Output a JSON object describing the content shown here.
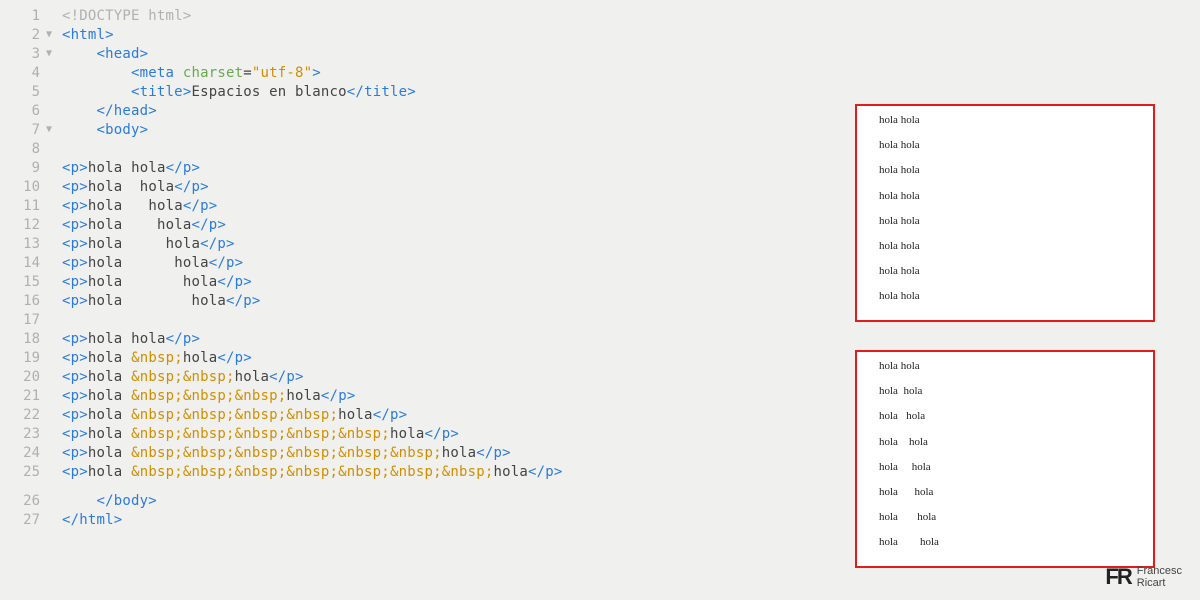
{
  "editor": {
    "lines": [
      {
        "n": 1,
        "fold": "",
        "code": [
          {
            "cls": "doctype",
            "t": "<!DOCTYPE html>"
          }
        ],
        "indent": 0
      },
      {
        "n": 2,
        "fold": "▼",
        "code": [
          {
            "cls": "bracket",
            "t": "<"
          },
          {
            "cls": "tag",
            "t": "html"
          },
          {
            "cls": "bracket",
            "t": ">"
          }
        ],
        "indent": 0
      },
      {
        "n": 3,
        "fold": "▼",
        "code": [
          {
            "cls": "bracket",
            "t": "<"
          },
          {
            "cls": "tag",
            "t": "head"
          },
          {
            "cls": "bracket",
            "t": ">"
          }
        ],
        "indent": 1
      },
      {
        "n": 4,
        "fold": "",
        "code": [
          {
            "cls": "bracket",
            "t": "<"
          },
          {
            "cls": "tag",
            "t": "meta"
          },
          {
            "cls": "text",
            "t": " "
          },
          {
            "cls": "attr",
            "t": "charset"
          },
          {
            "cls": "text",
            "t": "="
          },
          {
            "cls": "string",
            "t": "\"utf-8\""
          },
          {
            "cls": "bracket",
            "t": ">"
          }
        ],
        "indent": 2
      },
      {
        "n": 5,
        "fold": "",
        "code": [
          {
            "cls": "bracket",
            "t": "<"
          },
          {
            "cls": "tag",
            "t": "title"
          },
          {
            "cls": "bracket",
            "t": ">"
          },
          {
            "cls": "text",
            "t": "Espacios en blanco"
          },
          {
            "cls": "bracket",
            "t": "</"
          },
          {
            "cls": "tag",
            "t": "title"
          },
          {
            "cls": "bracket",
            "t": ">"
          }
        ],
        "indent": 2
      },
      {
        "n": 6,
        "fold": "",
        "code": [
          {
            "cls": "bracket",
            "t": "</"
          },
          {
            "cls": "tag",
            "t": "head"
          },
          {
            "cls": "bracket",
            "t": ">"
          }
        ],
        "indent": 1
      },
      {
        "n": 7,
        "fold": "▼",
        "code": [
          {
            "cls": "bracket",
            "t": "<"
          },
          {
            "cls": "tag",
            "t": "body"
          },
          {
            "cls": "bracket",
            "t": ">"
          }
        ],
        "indent": 1
      },
      {
        "n": 8,
        "fold": "",
        "code": [],
        "indent": 0
      },
      {
        "n": 9,
        "fold": "",
        "code": [
          {
            "cls": "bracket",
            "t": "<"
          },
          {
            "cls": "tag",
            "t": "p"
          },
          {
            "cls": "bracket",
            "t": ">"
          },
          {
            "cls": "text",
            "t": "hola hola"
          },
          {
            "cls": "bracket",
            "t": "</"
          },
          {
            "cls": "tag",
            "t": "p"
          },
          {
            "cls": "bracket",
            "t": ">"
          }
        ],
        "indent": 0
      },
      {
        "n": 10,
        "fold": "",
        "code": [
          {
            "cls": "bracket",
            "t": "<"
          },
          {
            "cls": "tag",
            "t": "p"
          },
          {
            "cls": "bracket",
            "t": ">"
          },
          {
            "cls": "text",
            "t": "hola  hola"
          },
          {
            "cls": "bracket",
            "t": "</"
          },
          {
            "cls": "tag",
            "t": "p"
          },
          {
            "cls": "bracket",
            "t": ">"
          }
        ],
        "indent": 0
      },
      {
        "n": 11,
        "fold": "",
        "code": [
          {
            "cls": "bracket",
            "t": "<"
          },
          {
            "cls": "tag",
            "t": "p"
          },
          {
            "cls": "bracket",
            "t": ">"
          },
          {
            "cls": "text",
            "t": "hola   hola"
          },
          {
            "cls": "bracket",
            "t": "</"
          },
          {
            "cls": "tag",
            "t": "p"
          },
          {
            "cls": "bracket",
            "t": ">"
          }
        ],
        "indent": 0
      },
      {
        "n": 12,
        "fold": "",
        "code": [
          {
            "cls": "bracket",
            "t": "<"
          },
          {
            "cls": "tag",
            "t": "p"
          },
          {
            "cls": "bracket",
            "t": ">"
          },
          {
            "cls": "text",
            "t": "hola    hola"
          },
          {
            "cls": "bracket",
            "t": "</"
          },
          {
            "cls": "tag",
            "t": "p"
          },
          {
            "cls": "bracket",
            "t": ">"
          }
        ],
        "indent": 0
      },
      {
        "n": 13,
        "fold": "",
        "code": [
          {
            "cls": "bracket",
            "t": "<"
          },
          {
            "cls": "tag",
            "t": "p"
          },
          {
            "cls": "bracket",
            "t": ">"
          },
          {
            "cls": "text",
            "t": "hola     hola"
          },
          {
            "cls": "bracket",
            "t": "</"
          },
          {
            "cls": "tag",
            "t": "p"
          },
          {
            "cls": "bracket",
            "t": ">"
          }
        ],
        "indent": 0
      },
      {
        "n": 14,
        "fold": "",
        "code": [
          {
            "cls": "bracket",
            "t": "<"
          },
          {
            "cls": "tag",
            "t": "p"
          },
          {
            "cls": "bracket",
            "t": ">"
          },
          {
            "cls": "text",
            "t": "hola      hola"
          },
          {
            "cls": "bracket",
            "t": "</"
          },
          {
            "cls": "tag",
            "t": "p"
          },
          {
            "cls": "bracket",
            "t": ">"
          }
        ],
        "indent": 0
      },
      {
        "n": 15,
        "fold": "",
        "code": [
          {
            "cls": "bracket",
            "t": "<"
          },
          {
            "cls": "tag",
            "t": "p"
          },
          {
            "cls": "bracket",
            "t": ">"
          },
          {
            "cls": "text",
            "t": "hola       hola"
          },
          {
            "cls": "bracket",
            "t": "</"
          },
          {
            "cls": "tag",
            "t": "p"
          },
          {
            "cls": "bracket",
            "t": ">"
          }
        ],
        "indent": 0
      },
      {
        "n": 16,
        "fold": "",
        "code": [
          {
            "cls": "bracket",
            "t": "<"
          },
          {
            "cls": "tag",
            "t": "p"
          },
          {
            "cls": "bracket",
            "t": ">"
          },
          {
            "cls": "text",
            "t": "hola        hola"
          },
          {
            "cls": "bracket",
            "t": "</"
          },
          {
            "cls": "tag",
            "t": "p"
          },
          {
            "cls": "bracket",
            "t": ">"
          }
        ],
        "indent": 0
      },
      {
        "n": 17,
        "fold": "",
        "code": [],
        "indent": 0
      },
      {
        "n": 18,
        "fold": "",
        "code": [
          {
            "cls": "bracket",
            "t": "<"
          },
          {
            "cls": "tag",
            "t": "p"
          },
          {
            "cls": "bracket",
            "t": ">"
          },
          {
            "cls": "text",
            "t": "hola hola"
          },
          {
            "cls": "bracket",
            "t": "</"
          },
          {
            "cls": "tag",
            "t": "p"
          },
          {
            "cls": "bracket",
            "t": ">"
          }
        ],
        "indent": 0
      },
      {
        "n": 19,
        "fold": "",
        "code": [
          {
            "cls": "bracket",
            "t": "<"
          },
          {
            "cls": "tag",
            "t": "p"
          },
          {
            "cls": "bracket",
            "t": ">"
          },
          {
            "cls": "text",
            "t": "hola "
          },
          {
            "cls": "entity",
            "t": "&nbsp;"
          },
          {
            "cls": "text",
            "t": "hola"
          },
          {
            "cls": "bracket",
            "t": "</"
          },
          {
            "cls": "tag",
            "t": "p"
          },
          {
            "cls": "bracket",
            "t": ">"
          }
        ],
        "indent": 0
      },
      {
        "n": 20,
        "fold": "",
        "code": [
          {
            "cls": "bracket",
            "t": "<"
          },
          {
            "cls": "tag",
            "t": "p"
          },
          {
            "cls": "bracket",
            "t": ">"
          },
          {
            "cls": "text",
            "t": "hola "
          },
          {
            "cls": "entity",
            "t": "&nbsp;&nbsp;"
          },
          {
            "cls": "text",
            "t": "hola"
          },
          {
            "cls": "bracket",
            "t": "</"
          },
          {
            "cls": "tag",
            "t": "p"
          },
          {
            "cls": "bracket",
            "t": ">"
          }
        ],
        "indent": 0
      },
      {
        "n": 21,
        "fold": "",
        "code": [
          {
            "cls": "bracket",
            "t": "<"
          },
          {
            "cls": "tag",
            "t": "p"
          },
          {
            "cls": "bracket",
            "t": ">"
          },
          {
            "cls": "text",
            "t": "hola "
          },
          {
            "cls": "entity",
            "t": "&nbsp;&nbsp;&nbsp;"
          },
          {
            "cls": "text",
            "t": "hola"
          },
          {
            "cls": "bracket",
            "t": "</"
          },
          {
            "cls": "tag",
            "t": "p"
          },
          {
            "cls": "bracket",
            "t": ">"
          }
        ],
        "indent": 0
      },
      {
        "n": 22,
        "fold": "",
        "code": [
          {
            "cls": "bracket",
            "t": "<"
          },
          {
            "cls": "tag",
            "t": "p"
          },
          {
            "cls": "bracket",
            "t": ">"
          },
          {
            "cls": "text",
            "t": "hola "
          },
          {
            "cls": "entity",
            "t": "&nbsp;&nbsp;&nbsp;&nbsp;"
          },
          {
            "cls": "text",
            "t": "hola"
          },
          {
            "cls": "bracket",
            "t": "</"
          },
          {
            "cls": "tag",
            "t": "p"
          },
          {
            "cls": "bracket",
            "t": ">"
          }
        ],
        "indent": 0
      },
      {
        "n": 23,
        "fold": "",
        "code": [
          {
            "cls": "bracket",
            "t": "<"
          },
          {
            "cls": "tag",
            "t": "p"
          },
          {
            "cls": "bracket",
            "t": ">"
          },
          {
            "cls": "text",
            "t": "hola "
          },
          {
            "cls": "entity",
            "t": "&nbsp;&nbsp;&nbsp;&nbsp;&nbsp;"
          },
          {
            "cls": "text",
            "t": "hola"
          },
          {
            "cls": "bracket",
            "t": "</"
          },
          {
            "cls": "tag",
            "t": "p"
          },
          {
            "cls": "bracket",
            "t": ">"
          }
        ],
        "indent": 0
      },
      {
        "n": 24,
        "fold": "",
        "code": [
          {
            "cls": "bracket",
            "t": "<"
          },
          {
            "cls": "tag",
            "t": "p"
          },
          {
            "cls": "bracket",
            "t": ">"
          },
          {
            "cls": "text",
            "t": "hola "
          },
          {
            "cls": "entity",
            "t": "&nbsp;&nbsp;&nbsp;&nbsp;&nbsp;&nbsp;"
          },
          {
            "cls": "text",
            "t": "hola"
          },
          {
            "cls": "bracket",
            "t": "</"
          },
          {
            "cls": "tag",
            "t": "p"
          },
          {
            "cls": "bracket",
            "t": ">"
          }
        ],
        "indent": 0
      },
      {
        "n": 25,
        "fold": "",
        "code": [
          {
            "cls": "bracket",
            "t": "<"
          },
          {
            "cls": "tag",
            "t": "p"
          },
          {
            "cls": "bracket",
            "t": ">"
          },
          {
            "cls": "text",
            "t": "hola "
          },
          {
            "cls": "entity",
            "t": "&nbsp;&nbsp;&nbsp;&nbsp;&nbsp;&nbsp;&nbsp;"
          },
          {
            "cls": "text",
            "t": "hola"
          },
          {
            "cls": "bracket",
            "t": "</"
          },
          {
            "cls": "tag",
            "t": "p"
          },
          {
            "cls": "bracket",
            "t": ">"
          }
        ],
        "indent": 0
      }
    ],
    "tail": [
      {
        "n": 26,
        "fold": "",
        "code": [
          {
            "cls": "bracket",
            "t": "</"
          },
          {
            "cls": "tag",
            "t": "body"
          },
          {
            "cls": "bracket",
            "t": ">"
          }
        ],
        "indent": 1
      },
      {
        "n": 27,
        "fold": "",
        "code": [
          {
            "cls": "bracket",
            "t": "</"
          },
          {
            "cls": "tag",
            "t": "html"
          },
          {
            "cls": "bracket",
            "t": ">"
          }
        ],
        "indent": 0
      }
    ],
    "indent_unit": "    "
  },
  "render": {
    "box1": [
      "hola hola",
      "hola hola",
      "hola hola",
      "hola hola",
      "hola hola",
      "hola hola",
      "hola hola",
      "hola hola"
    ],
    "box2": [
      "hola hola",
      "hola  hola",
      "hola   hola",
      "hola    hola",
      "hola     hola",
      "hola      hola",
      "hola       hola",
      "hola        hola"
    ]
  },
  "logo": {
    "mark": "FR",
    "line1": "Francesc",
    "line2": "Ricart"
  }
}
